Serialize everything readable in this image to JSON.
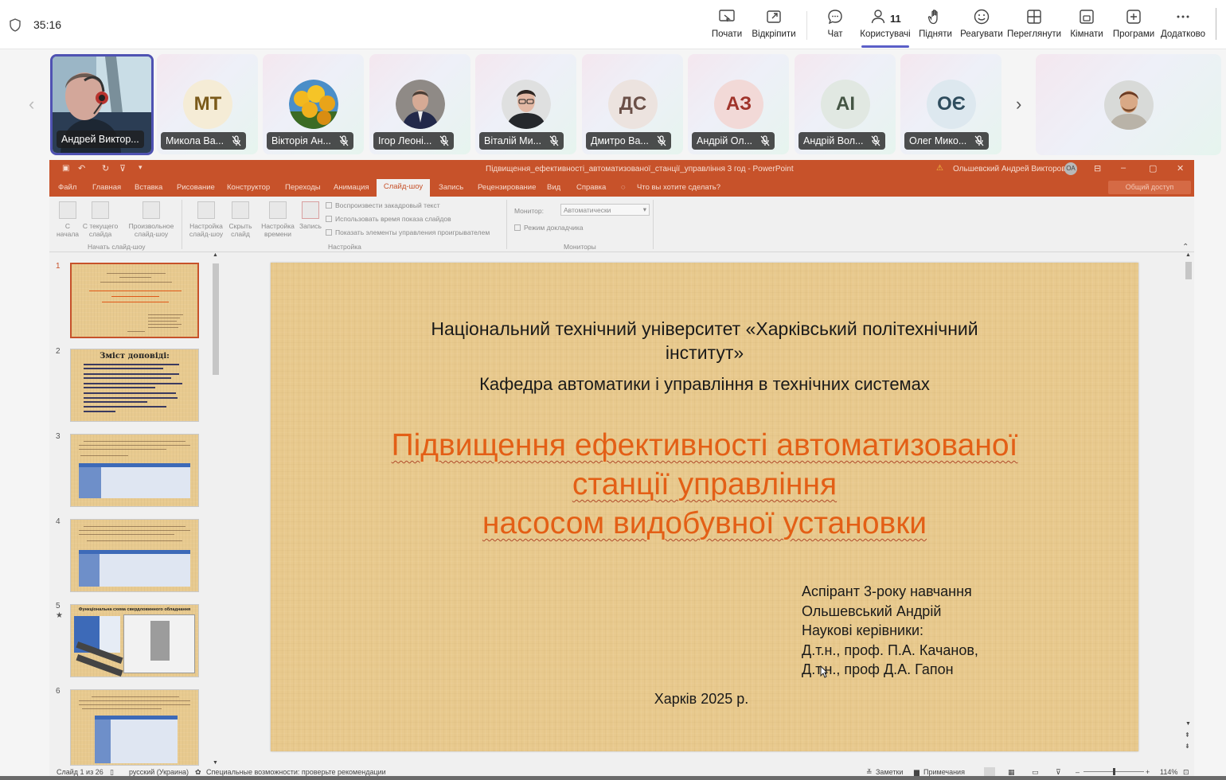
{
  "meeting": {
    "timer": "35:16",
    "participants_count": "11",
    "toolbar": [
      {
        "label": "Почати",
        "icon": "present-screen-icon"
      },
      {
        "label": "Відкріпити",
        "icon": "popout-icon"
      },
      {
        "label": "Чат",
        "icon": "chat-icon"
      },
      {
        "label": "Користувачі",
        "icon": "people-icon"
      },
      {
        "label": "Підняти",
        "icon": "raise-hand-icon"
      },
      {
        "label": "Реагувати",
        "icon": "emoji-icon"
      },
      {
        "label": "Переглянути",
        "icon": "view-grid-icon"
      },
      {
        "label": "Кімнати",
        "icon": "breakout-rooms-icon"
      },
      {
        "label": "Програми",
        "icon": "add-app-icon"
      },
      {
        "label": "Додатково",
        "icon": "more-icon"
      }
    ]
  },
  "participants": [
    {
      "name": "Андрей Виктор...",
      "avatar": "video",
      "muted": false
    },
    {
      "name": "Микола Ва...",
      "initials": "МТ",
      "avatar_color": "#f5ecd6",
      "text_color": "#7a5a1a",
      "muted": true
    },
    {
      "name": "Вікторія Ан...",
      "avatar": "photo-flowers",
      "muted": true
    },
    {
      "name": "Ігор Леоні...",
      "avatar": "photo",
      "muted": true
    },
    {
      "name": "Віталій Ми...",
      "avatar": "photo",
      "muted": true
    },
    {
      "name": "Дмитро Ва...",
      "initials": "ДС",
      "avatar_color": "#ece3df",
      "text_color": "#6b5048",
      "muted": true
    },
    {
      "name": "Андрій Ол...",
      "initials": "АЗ",
      "avatar_color": "#f2d9d7",
      "text_color": "#a0342b",
      "muted": true
    },
    {
      "name": "Андрій Вол...",
      "initials": "АІ",
      "avatar_color": "#e1e8e2",
      "text_color": "#445544",
      "muted": true
    },
    {
      "name": "Олег Мико...",
      "initials": "ОЄ",
      "avatar_color": "#dde8ef",
      "text_color": "#2f4d5e",
      "muted": true
    }
  ],
  "ppt": {
    "window_title": "Підвищення_ефективності_автоматизованої_станції_управління 3 год  -  PowerPoint",
    "user_name": "Ольшевский Андрей Викторович",
    "user_initials": "ОА",
    "tabs": [
      "Файл",
      "Главная",
      "Вставка",
      "Рисование",
      "Конструктор",
      "Переходы",
      "Анимация",
      "Слайд-шоу",
      "Запись",
      "Рецензирование",
      "Вид",
      "Справка",
      "Что вы хотите сделать?"
    ],
    "active_tab": "Слайд-шоу",
    "share": "Общий доступ",
    "ribbon": {
      "buttons": [
        {
          "label1": "С",
          "label2": "начала"
        },
        {
          "label1": "С текущего",
          "label2": "слайда"
        },
        {
          "label1": "Произвольное",
          "label2": "слайд-шоу"
        },
        {
          "label1": "Настройка",
          "label2": "слайд-шоу"
        },
        {
          "label1": "Скрыть",
          "label2": "слайд"
        },
        {
          "label1": "Настройка",
          "label2": "времени"
        },
        {
          "label1": "Запись",
          "label2": ""
        }
      ],
      "checkboxes": [
        "Воспроизвести закадровый текст",
        "Использовать время показа слайдов",
        "Показать элементы управления проигрывателем"
      ],
      "monitor_label": "Монитор:",
      "monitor_value": "Автоматически",
      "presenter_view": "Режим докладчика",
      "groups": [
        "Начать слайд-шоу",
        "Настройка",
        "Мониторы"
      ]
    },
    "slide": {
      "university": "Національний технічний університет «Харківський політехнічний інститут»",
      "department": "Кафедра автоматики і управління в технічних системах",
      "title_line1": "Підвищення ефективності автоматизованої",
      "title_line2": "станції управління",
      "title_line3": "насосом видобувної установки",
      "author": [
        "Аспірант 3-року навчання",
        "Ольшевський Андрій",
        "Наукові керівники:",
        "Д.т.н., проф. П.А. Качанов,",
        "Д.т.н., проф Д.А. Гапон"
      ],
      "city": "Харків 2025 р."
    },
    "thumbnails": [
      {
        "num": "1"
      },
      {
        "num": "2",
        "heading": "Зміст доповіді:"
      },
      {
        "num": "3"
      },
      {
        "num": "4"
      },
      {
        "num": "5",
        "heading": "Функціональна схема  свердловинного обладнання"
      },
      {
        "num": "6"
      }
    ],
    "status": {
      "slide": "Слайд 1 из 26",
      "lang": "русский (Украина)",
      "accessibility": "Специальные возможности: проверьте рекомендации",
      "notes": "Заметки",
      "comments": "Примечания",
      "zoom": "114%"
    }
  }
}
